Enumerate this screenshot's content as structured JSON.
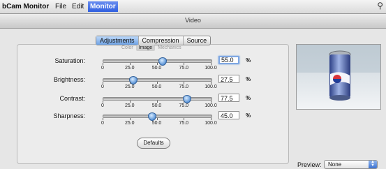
{
  "menubar": {
    "app_name": "bCam Monitor",
    "items": [
      "File",
      "Edit",
      "Monitor"
    ]
  },
  "window": {
    "title": "Video"
  },
  "tabs": [
    "Adjustments",
    "Compression",
    "Source"
  ],
  "subtabs": [
    "Color",
    "Image",
    "Mechanics"
  ],
  "sliders": [
    {
      "label": "Saturation:",
      "value": "55.0",
      "level": 0.55
    },
    {
      "label": "Brightness:",
      "value": "27.5",
      "level": 0.275
    },
    {
      "label": "Contrast:",
      "value": "77.5",
      "level": 0.775
    },
    {
      "label": "Sharpness:",
      "value": "45.0",
      "level": 0.45
    }
  ],
  "scale_labels": [
    "0",
    "25.0",
    "50.0",
    "75.0",
    "100.0"
  ],
  "unit": "%",
  "defaults_label": "Defaults",
  "preview": {
    "label": "Preview:",
    "selected": "None"
  },
  "colors": {
    "accent": "#3f6fd9",
    "window_bg": "#e6e6e6"
  }
}
